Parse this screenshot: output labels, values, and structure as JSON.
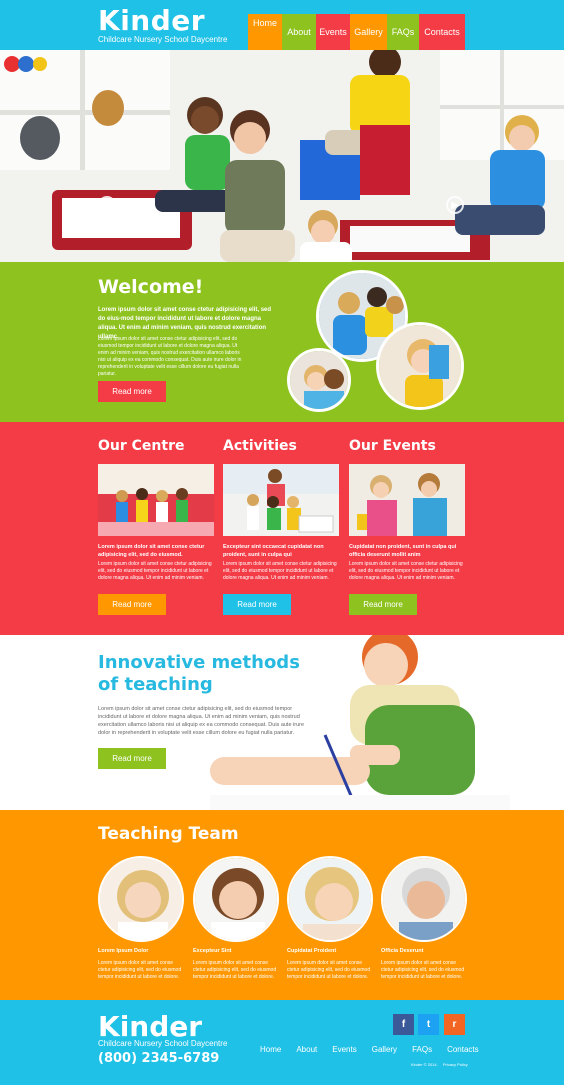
{
  "header": {
    "logo_title": "Kinder",
    "logo_subtitle": "Childcare Nursery School Daycentre",
    "nav": [
      {
        "label": "Home",
        "color": "#ff9800"
      },
      {
        "label": "About",
        "color": "#8dc21f"
      },
      {
        "label": "Events",
        "color": "#f43c47"
      },
      {
        "label": "Gallery",
        "color": "#ff9800"
      },
      {
        "label": "FAQs",
        "color": "#8dc21f"
      },
      {
        "label": "Contacts",
        "color": "#f43c47"
      }
    ]
  },
  "hero": {
    "prev_icon": "arrow-left-icon",
    "next_icon": "arrow-right-icon"
  },
  "welcome": {
    "title": "Welcome!",
    "bold_text": "Lorem ipsum dolor sit amet conse ctetur adipisicing elit, sed do eius-mod tempor incididunt ut labore et dolore magna aliqua. Ut enim ad minim veniam, quis nostrud exercitation ullamc.",
    "text": "Lorem ipsum dolor sit amet conse ctetur adipisicing elit, sed do eiusmod tempor incididunt ut labore et dolore magna aliqua. Ut enim ad minim veniam, quis nostrud exercitation ullamco laboris nisi ut aliquip ex ea commodo consequat. Duis aute irure dolor in reprehenderit in voluptate velit esse cillum dolore eu fugiat nulla pariatur.",
    "button": "Read more"
  },
  "columns": [
    {
      "title": "Our Centre",
      "bold": "Lorem ipsum dolor sit amet conse ctetur adipisicing elit, sed do eiusmod.",
      "text": "Lorem ipsum dolor sit amet conse ctetur adipisicing elit, sed do eiusmod tempor incididunt ut labore et dolore magna aliqua. Ut enim ad minim veniam.",
      "button": "Read more",
      "btn_color": "#ff9800"
    },
    {
      "title": "Activities",
      "bold": "Excepteur sint occaecat cupidatat non proident, sunt in culpa qui",
      "text": "Lorem ipsum dolor sit amet conse ctetur adipisicing elit, sed do eiusmod tempor incididunt ut labore et dolore magna aliqua. Ut enim ad minim veniam.",
      "button": "Read more",
      "btn_color": "#1fc1e6"
    },
    {
      "title": "Our Events",
      "bold": "Cupidatat non proident, sunt in culpa qui officia deserunt mollit anim",
      "text": "Lorem ipsum dolor sit amet conse ctetur adipisicing elit, sed do eiusmod tempor incididunt ut labore et dolore magna aliqua. Ut enim ad minim veniam.",
      "button": "Read more",
      "btn_color": "#8dc21f"
    }
  ],
  "innovative": {
    "title_line1": "Innovative methods",
    "title_line2": "of teaching",
    "text": "Lorem ipsum dolor sit amet conse ctetur adipisicing elit, sed do eiusmod tempor incididunt ut labore et dolore magna aliqua. Ut enim ad minim veniam, quis nostrud exercitation ullamco laboris nisi ut aliquip ex ea commodo consequat. Duis aute irure dolor in reprehenderit in voluptate velit esse cillum dolore eu fugiat nulla pariatur.",
    "button": "Read more"
  },
  "team": {
    "title": "Teaching Team",
    "members": [
      {
        "name": "Lorem Ipsum Dolor",
        "text": "Lorem ipsum dolor sit amet conse ctetur adipisicing elit, sed do eiusmod tempor incididunt ut labore et dolore."
      },
      {
        "name": "Excepteur Sint",
        "text": "Lorem ipsum dolor sit amet conse ctetur adipisicing elit, sed do eiusmod tempor incididunt ut labore et dolore."
      },
      {
        "name": "Cupidatat Proident",
        "text": "Lorem ipsum dolor sit amet conse ctetur adipisicing elit, sed do eiusmod tempor incididunt ut labore et dolore."
      },
      {
        "name": "Officia Deserunt",
        "text": "Lorem ipsum dolor sit amet conse ctetur adipisicing elit, sed do eiusmod tempor incididunt ut labore et dolore."
      }
    ]
  },
  "footer": {
    "logo_title": "Kinder",
    "logo_subtitle": "Childcare Nursery School Daycentre",
    "phone": "(800) 2345-6789",
    "nav": [
      "Home",
      "About",
      "Events",
      "Gallery",
      "FAQs",
      "Contacts"
    ],
    "social": [
      {
        "icon": "facebook-icon",
        "glyph": "f",
        "color": "#3b5998"
      },
      {
        "icon": "twitter-icon",
        "glyph": "t",
        "color": "#1da1f2"
      },
      {
        "icon": "rss-icon",
        "glyph": "r",
        "color": "#f26522"
      }
    ],
    "copyright": "Kinder © 2014.",
    "privacy": "Privacy Policy"
  }
}
